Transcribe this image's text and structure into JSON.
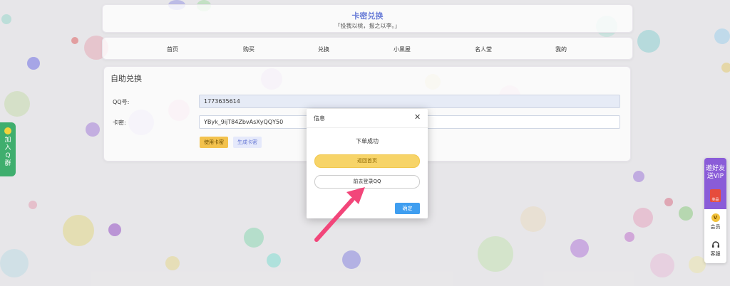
{
  "site": {
    "title": "卡密兑换",
    "subtitle": "「投我以桃，报之以李。」"
  },
  "nav": {
    "items": [
      "首页",
      "购买",
      "兑换",
      "小黑屋",
      "名人堂",
      "我的"
    ]
  },
  "form": {
    "title": "自助兑换",
    "qq_label": "QQ号:",
    "qq_value": "1773635614",
    "card_label": "卡密:",
    "card_value": "YByk_9ijT84ZbvAsXyQQY50",
    "use_button": "使用卡密",
    "generate_button": "生成卡密"
  },
  "left_tab": {
    "lines": [
      "加",
      "入",
      "Q",
      "群"
    ]
  },
  "right_bar": {
    "vip_line1": "邀好友",
    "vip_line2": "送VIP",
    "vip_small": "奖品",
    "member_icon": "V",
    "member_label": "会员",
    "service_label": "客服"
  },
  "dialog": {
    "title": "信息",
    "message": "下单成功",
    "home_button": "返回首页",
    "qq_button": "前去登录QQ",
    "ok_button": "确定"
  },
  "icons": [
    "smiley-icon",
    "close-icon",
    "vip-badge-icon",
    "headset-icon",
    "arrow-annotation"
  ],
  "colors": {
    "accent": "#3f9ef0",
    "title": "#6c7fd8",
    "group_green": "#3fae6e",
    "vip_purple": "#8a5cd8",
    "home_yellow": "#f7d468",
    "arrow_pink": "#f2467a"
  }
}
